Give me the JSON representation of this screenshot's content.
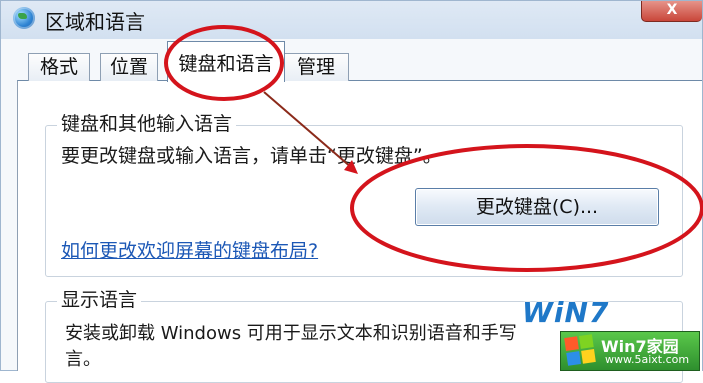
{
  "window": {
    "title": "区域和语言",
    "close_label": "X"
  },
  "tabs": [
    {
      "label": "格式"
    },
    {
      "label": "位置"
    },
    {
      "label": "键盘和语言",
      "active": true
    },
    {
      "label": "管理"
    }
  ],
  "keyboard_group": {
    "title": "键盘和其他输入语言",
    "instruction": "要更改键盘或输入语言，请单击“更改键盘”。",
    "change_button": "更改键盘(C)...",
    "help_link": "如何更改欢迎屏幕的键盘布局?"
  },
  "display_group": {
    "title": "显示语言",
    "description_line1": "安装或卸载 Windows 可用于显示文本和识别语音和手写",
    "description_line2": "言。"
  },
  "watermark": {
    "brand": "WiN7",
    "site_name": "Win7家园",
    "url": "www.5aixt.com"
  },
  "colors": {
    "annotation_red": "#d4141c",
    "link_blue": "#1c58b6",
    "titlebar": "#d8e4f2"
  }
}
